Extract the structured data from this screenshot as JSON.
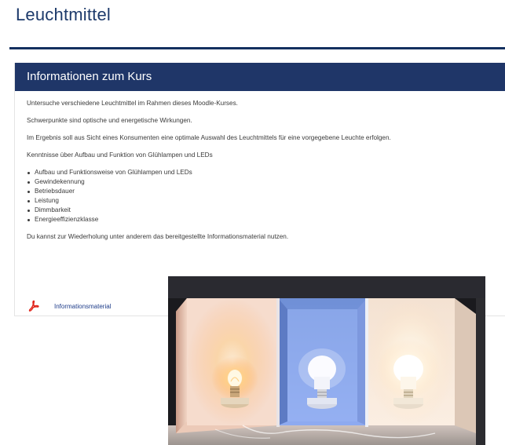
{
  "header": {
    "title": "Leuchtmittel"
  },
  "course_info": {
    "heading": "Informationen zum Kurs",
    "paragraphs": [
      "Untersuche verschiedene Leuchtmittel im Rahmen dieses Moodle-Kurses.",
      "Schwerpunkte sind optische und energetische Wirkungen.",
      "Im Ergebnis soll aus Sicht eines Konsumenten eine optimale Auswahl des Leuchtmittels für eine vorgegebene Leuchte erfolgen.",
      "Kenntnisse über Aufbau und Funktion von Glühlampen und LEDs"
    ],
    "bullets": [
      "Aufbau und Funktionsweise von Glühlampen und LEDs",
      "Gewindekennung",
      "Betriebsdauer",
      "Leistung",
      "Dimmbarkeit",
      "Energieeffizienzklasse"
    ],
    "closing": "Du kannst zur Wiederholung unter anderem das bereitgestellte Informationsmaterial nutzen."
  },
  "resource": {
    "label": "Informationsmaterial",
    "icon": "pdf-icon",
    "icon_color": "#e0251b"
  },
  "photo": {
    "icon": "lamp-comparison-photo"
  },
  "colors": {
    "brand": "#1f3668",
    "title": "#1d3a6b",
    "link": "#1f3d8a"
  }
}
